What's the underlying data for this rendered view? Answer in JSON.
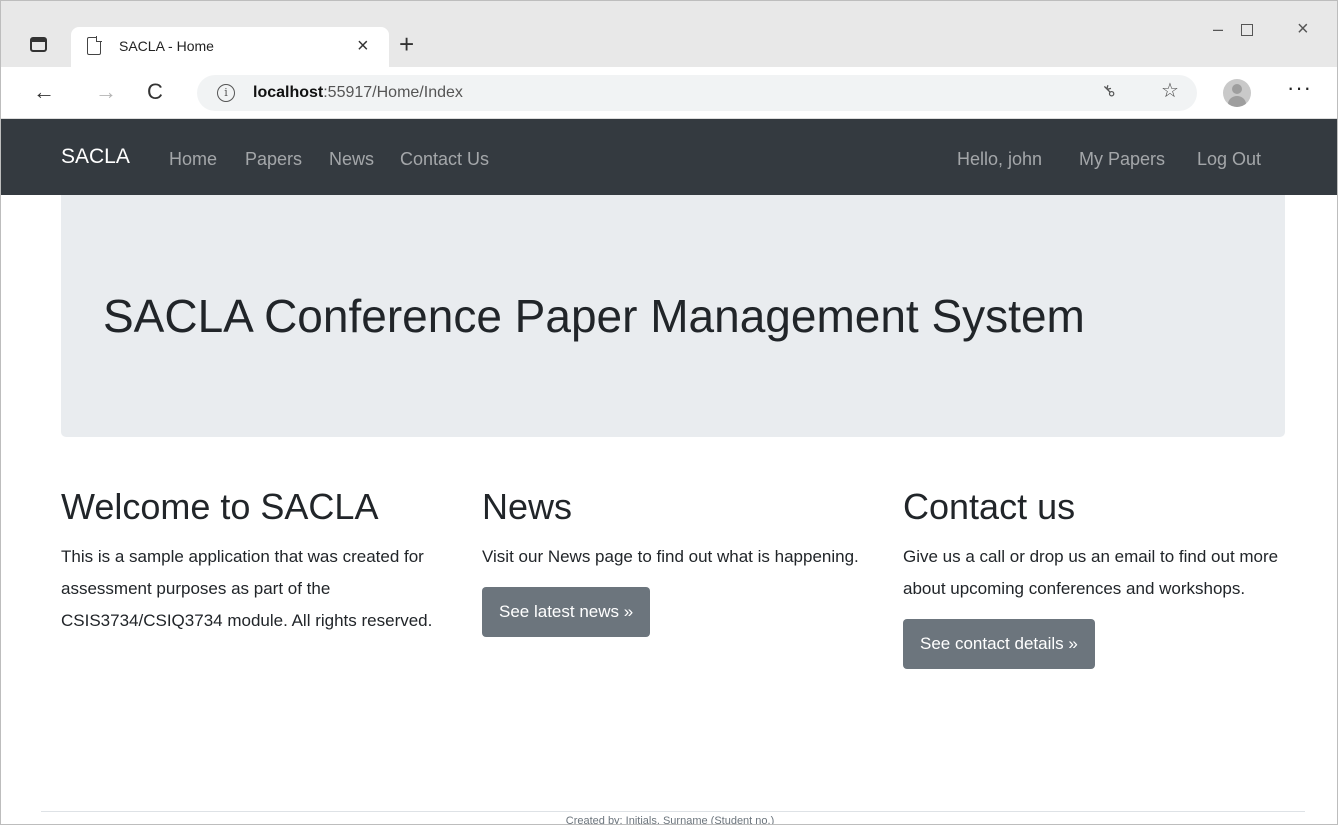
{
  "browser": {
    "tab_title": "SACLA - Home",
    "tab_close": "×",
    "new_tab": "+",
    "url_host": "localhost",
    "url_path": ":55917/Home/Index",
    "window_controls": {
      "minimize": "–",
      "close": "×"
    },
    "nav": {
      "back": "←",
      "forward": "→",
      "reload": "C"
    },
    "more": "···",
    "icons": [
      "tab-actions-icon",
      "page-icon",
      "info-icon",
      "key-icon",
      "favorites-icon",
      "profile-icon"
    ]
  },
  "navbar": {
    "brand": "SACLA",
    "links": [
      "Home",
      "Papers",
      "News",
      "Contact Us"
    ],
    "right": {
      "greeting": "Hello, john",
      "my_papers": "My Papers",
      "logout": "Log Out"
    }
  },
  "jumbotron": {
    "title": "SACLA Conference Paper Management System"
  },
  "columns": [
    {
      "heading": "Welcome to SACLA",
      "text": "This is a sample application that was created for assessment purposes as part of the CSIS3734/CSIQ3734 module. All rights reserved."
    },
    {
      "heading": "News",
      "text": "Visit our News page to find out what is happening.",
      "button": "See latest news »"
    },
    {
      "heading": "Contact us",
      "text": "Give us a call or drop us an email to find out more about upcoming conferences and workshops.",
      "button": "See contact details »"
    }
  ],
  "footer": {
    "text": "Created by: Initials, Surname (Student no.)"
  },
  "colors": {
    "navbar_bg": "#343a40",
    "jumbotron_bg": "#e9ecef",
    "button_bg": "#6c757d"
  }
}
